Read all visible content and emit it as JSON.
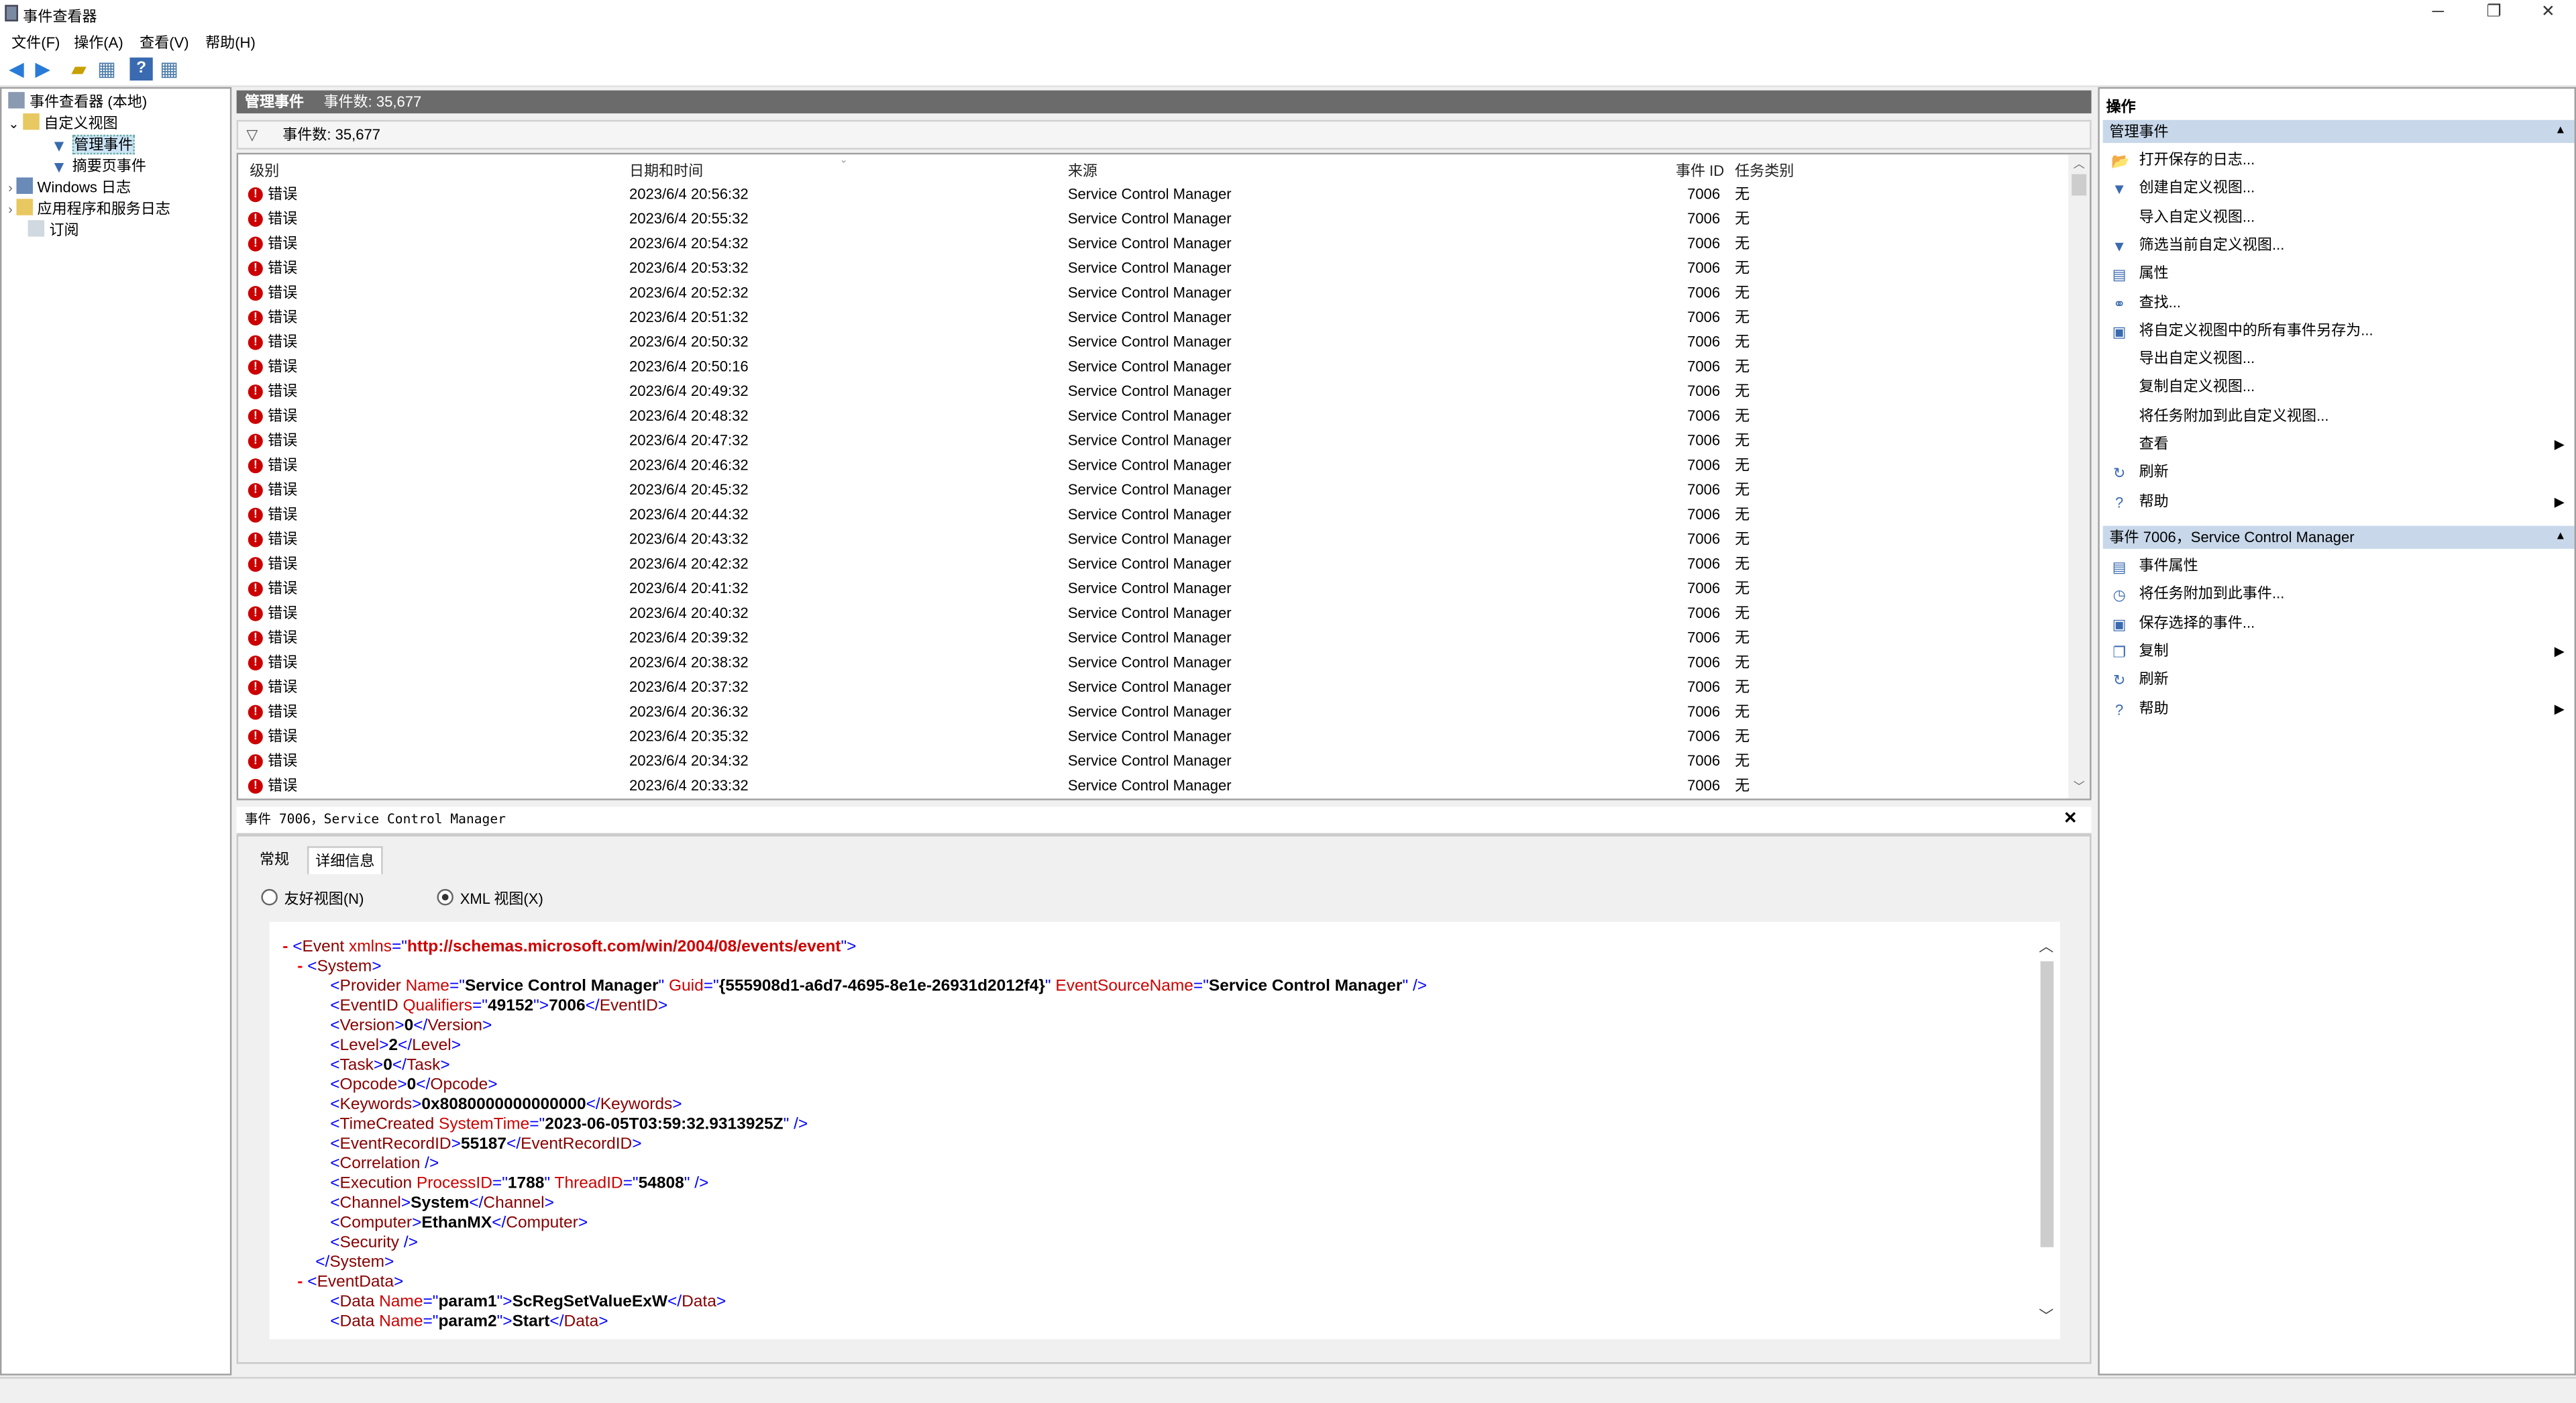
{
  "window": {
    "title": "事件查看器",
    "min": "─",
    "restore": "❐",
    "close": "✕"
  },
  "menu": [
    "文件(F)",
    "操作(A)",
    "查看(V)",
    "帮助(H)"
  ],
  "tree": {
    "root": "事件查看器 (本地)",
    "custom_views": "自定义视图",
    "admin_events": "管理事件",
    "summary_events": "摘要页事件",
    "windows_logs": "Windows 日志",
    "app_service_logs": "应用程序和服务日志",
    "subscriptions": "订阅"
  },
  "center": {
    "header_title": "管理事件",
    "header_count": "事件数: 35,677",
    "filter_text": "事件数: 35,677",
    "columns": {
      "level": "级别",
      "datetime": "日期和时间",
      "source": "来源",
      "event_id": "事件 ID",
      "task": "任务类别"
    },
    "rows": [
      {
        "level": "错误",
        "time": "2023/6/4 20:56:32",
        "source": "Service Control Manager",
        "id": "7006",
        "task": "无"
      },
      {
        "level": "错误",
        "time": "2023/6/4 20:55:32",
        "source": "Service Control Manager",
        "id": "7006",
        "task": "无"
      },
      {
        "level": "错误",
        "time": "2023/6/4 20:54:32",
        "source": "Service Control Manager",
        "id": "7006",
        "task": "无"
      },
      {
        "level": "错误",
        "time": "2023/6/4 20:53:32",
        "source": "Service Control Manager",
        "id": "7006",
        "task": "无"
      },
      {
        "level": "错误",
        "time": "2023/6/4 20:52:32",
        "source": "Service Control Manager",
        "id": "7006",
        "task": "无"
      },
      {
        "level": "错误",
        "time": "2023/6/4 20:51:32",
        "source": "Service Control Manager",
        "id": "7006",
        "task": "无"
      },
      {
        "level": "错误",
        "time": "2023/6/4 20:50:32",
        "source": "Service Control Manager",
        "id": "7006",
        "task": "无"
      },
      {
        "level": "错误",
        "time": "2023/6/4 20:50:16",
        "source": "Service Control Manager",
        "id": "7006",
        "task": "无"
      },
      {
        "level": "错误",
        "time": "2023/6/4 20:49:32",
        "source": "Service Control Manager",
        "id": "7006",
        "task": "无"
      },
      {
        "level": "错误",
        "time": "2023/6/4 20:48:32",
        "source": "Service Control Manager",
        "id": "7006",
        "task": "无"
      },
      {
        "level": "错误",
        "time": "2023/6/4 20:47:32",
        "source": "Service Control Manager",
        "id": "7006",
        "task": "无"
      },
      {
        "level": "错误",
        "time": "2023/6/4 20:46:32",
        "source": "Service Control Manager",
        "id": "7006",
        "task": "无"
      },
      {
        "level": "错误",
        "time": "2023/6/4 20:45:32",
        "source": "Service Control Manager",
        "id": "7006",
        "task": "无"
      },
      {
        "level": "错误",
        "time": "2023/6/4 20:44:32",
        "source": "Service Control Manager",
        "id": "7006",
        "task": "无"
      },
      {
        "level": "错误",
        "time": "2023/6/4 20:43:32",
        "source": "Service Control Manager",
        "id": "7006",
        "task": "无"
      },
      {
        "level": "错误",
        "time": "2023/6/4 20:42:32",
        "source": "Service Control Manager",
        "id": "7006",
        "task": "无"
      },
      {
        "level": "错误",
        "time": "2023/6/4 20:41:32",
        "source": "Service Control Manager",
        "id": "7006",
        "task": "无"
      },
      {
        "level": "错误",
        "time": "2023/6/4 20:40:32",
        "source": "Service Control Manager",
        "id": "7006",
        "task": "无"
      },
      {
        "level": "错误",
        "time": "2023/6/4 20:39:32",
        "source": "Service Control Manager",
        "id": "7006",
        "task": "无"
      },
      {
        "level": "错误",
        "time": "2023/6/4 20:38:32",
        "source": "Service Control Manager",
        "id": "7006",
        "task": "无"
      },
      {
        "level": "错误",
        "time": "2023/6/4 20:37:32",
        "source": "Service Control Manager",
        "id": "7006",
        "task": "无"
      },
      {
        "level": "错误",
        "time": "2023/6/4 20:36:32",
        "source": "Service Control Manager",
        "id": "7006",
        "task": "无"
      },
      {
        "level": "错误",
        "time": "2023/6/4 20:35:32",
        "source": "Service Control Manager",
        "id": "7006",
        "task": "无"
      },
      {
        "level": "错误",
        "time": "2023/6/4 20:34:32",
        "source": "Service Control Manager",
        "id": "7006",
        "task": "无"
      },
      {
        "level": "错误",
        "time": "2023/6/4 20:33:32",
        "source": "Service Control Manager",
        "id": "7006",
        "task": "无"
      }
    ]
  },
  "detail": {
    "title": "事件 7006，Service Control Manager",
    "close": "✕",
    "tab_general": "常规",
    "tab_details": "详细信息",
    "radio_friendly": "友好视图(N)",
    "radio_xml": "XML 视图(X)",
    "xml": {
      "minus": "-",
      "event": "Event",
      "xmlns": "xmlns",
      "ns_value": "http://schemas.microsoft.com/win/2004/08/events/event",
      "system": "System",
      "provider": "Provider",
      "provider_name_attr": "Name",
      "provider_name": "Service Control Manager",
      "guid_attr": "Guid",
      "guid": "{555908d1-a6d7-4695-8e1e-26931d2012f4}",
      "esn_attr": "EventSourceName",
      "esn": "Service Control Manager",
      "eventid_tag": "EventID",
      "qualifiers_attr": "Qualifiers",
      "qualifiers": "49152",
      "eventid": "7006",
      "version_tag": "Version",
      "version": "0",
      "level_tag": "Level",
      "level": "2",
      "task_tag": "Task",
      "task": "0",
      "opcode_tag": "Opcode",
      "opcode": "0",
      "keywords_tag": "Keywords",
      "keywords": "0x8080000000000000",
      "timecreated_tag": "TimeCreated",
      "systemtime_attr": "SystemTime",
      "systemtime": "2023-06-05T03:59:32.9313925Z",
      "recordid_tag": "EventRecordID",
      "recordid": "55187",
      "correlation_tag": "Correlation",
      "execution_tag": "Execution",
      "pid_attr": "ProcessID",
      "pid": "1788",
      "tid_attr": "ThreadID",
      "tid": "54808",
      "channel_tag": "Channel",
      "channel": "System",
      "computer_tag": "Computer",
      "computer": "EthanMX",
      "security_tag": "Security",
      "eventdata_tag": "EventData",
      "data_tag": "Data",
      "data_name_attr": "Name",
      "param1": "param1",
      "param1_val": "ScRegSetValueExW",
      "param2": "param2",
      "param2_val": "Start"
    }
  },
  "actions": {
    "title": "操作",
    "section1": "管理事件",
    "items1": [
      {
        "label": "打开保存的日志...",
        "icon": "folder-open-icon",
        "glyph": "📂"
      },
      {
        "label": "创建自定义视图...",
        "icon": "filter-add-icon",
        "glyph": "▼"
      },
      {
        "label": "导入自定义视图...",
        "icon": "none",
        "glyph": ""
      },
      {
        "label": "筛选当前自定义视图...",
        "icon": "filter-icon",
        "glyph": "▼"
      },
      {
        "label": "属性",
        "icon": "properties-icon",
        "glyph": "▤"
      },
      {
        "label": "查找...",
        "icon": "binoculars-icon",
        "glyph": "⚭"
      },
      {
        "label": "将自定义视图中的所有事件另存为...",
        "icon": "save-icon",
        "glyph": "▣"
      },
      {
        "label": "导出自定义视图...",
        "icon": "none",
        "glyph": ""
      },
      {
        "label": "复制自定义视图...",
        "icon": "none",
        "glyph": ""
      },
      {
        "label": "将任务附加到此自定义视图...",
        "icon": "none",
        "glyph": ""
      },
      {
        "label": "查看",
        "icon": "none",
        "glyph": "",
        "arrow": "▶"
      },
      {
        "label": "刷新",
        "icon": "refresh-icon",
        "glyph": "↻"
      },
      {
        "label": "帮助",
        "icon": "help-icon",
        "glyph": "?",
        "arrow": "▶"
      }
    ],
    "section2": "事件 7006，Service Control Manager",
    "items2": [
      {
        "label": "事件属性",
        "icon": "properties-icon",
        "glyph": "▤"
      },
      {
        "label": "将任务附加到此事件...",
        "icon": "task-icon",
        "glyph": "◷"
      },
      {
        "label": "保存选择的事件...",
        "icon": "save-icon",
        "glyph": "▣"
      },
      {
        "label": "复制",
        "icon": "copy-icon",
        "glyph": "❐",
        "arrow": "▶"
      },
      {
        "label": "刷新",
        "icon": "refresh-icon",
        "glyph": "↻"
      },
      {
        "label": "帮助",
        "icon": "help-icon",
        "glyph": "?",
        "arrow": "▶"
      }
    ]
  }
}
